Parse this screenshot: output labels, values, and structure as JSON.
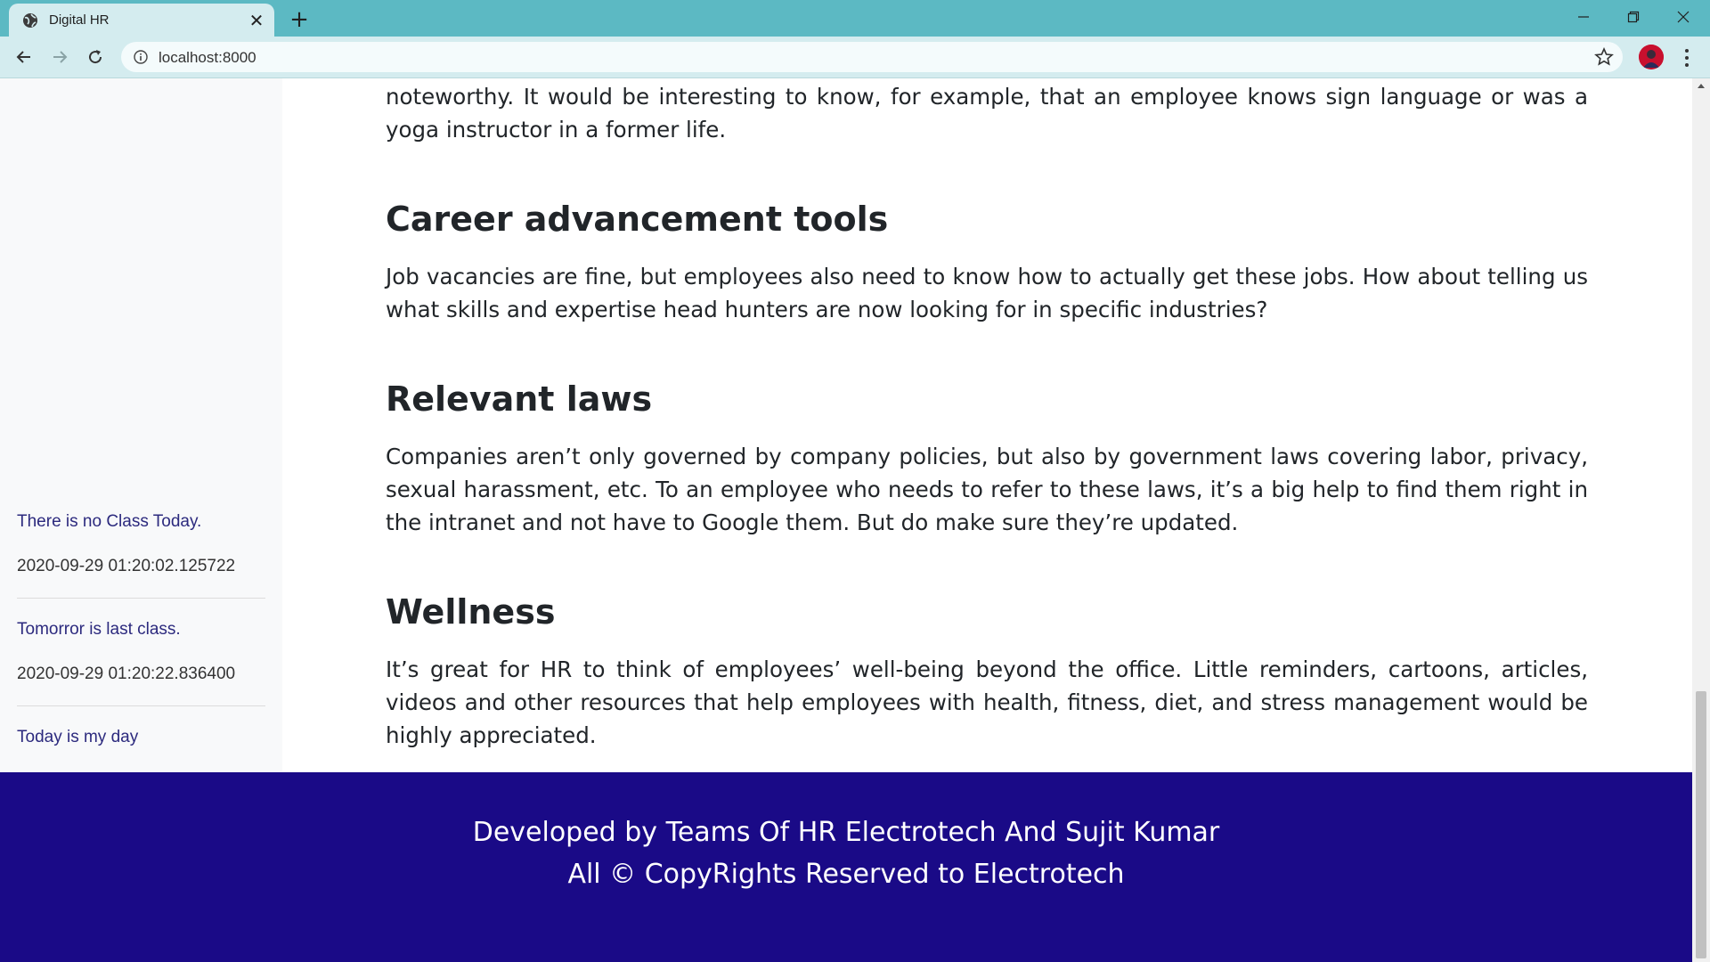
{
  "browser": {
    "tab_title": "Digital HR",
    "tab_close": "✕",
    "new_tab": "+",
    "url": "localhost:8000"
  },
  "sidebar": {
    "items": [
      {
        "notice": "There is no Class Today.",
        "timestamp": "2020-09-29 01:20:02.125722"
      },
      {
        "notice": "Tomorror is last class.",
        "timestamp": "2020-09-29 01:20:22.836400"
      },
      {
        "notice": "Today is my day"
      }
    ]
  },
  "content": {
    "intro_paragraph": "noteworthy. It would be interesting to know, for example, that an employee knows sign language or was a yoga instructor in a former life.",
    "sections": [
      {
        "heading": "Career advancement tools",
        "body": "Job vacancies are fine, but employees also need to know how to actually get these jobs. How about telling us what skills and expertise head hunters are now looking for in specific industries?"
      },
      {
        "heading": "Relevant laws",
        "body": "Companies aren’t only governed by company policies, but also by government laws covering labor, privacy, sexual harassment, etc. To an employee who needs to refer to these laws, it’s a big help to find them right in the intranet and not have to Google them. But do make sure they’re updated."
      },
      {
        "heading": "Wellness",
        "body": "It’s great for HR to think of employees’ well-being beyond the office. Little reminders, cartoons, articles, videos and other resources that help employees with health, fitness, diet, and stress management would be highly appreciated."
      }
    ]
  },
  "footer": {
    "line1": "Developed by Teams Of HR Electrotech And Sujit Kumar",
    "line2": "All © CopyRights Reserved to Electrotech"
  },
  "colors": {
    "tabbar": "#5cb9c3",
    "toolbar": "#d4ecef",
    "footer_bg": "#1a0a87",
    "sidebar_notice": "#2c2a7e"
  }
}
